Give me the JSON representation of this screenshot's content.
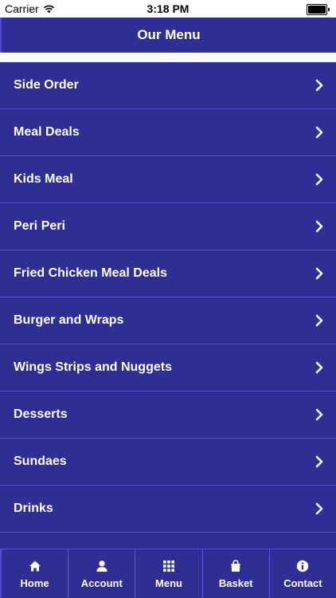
{
  "status_bar": {
    "carrier": "Carrier",
    "time": "3:18 PM"
  },
  "header": {
    "title": "Our Menu"
  },
  "menu": {
    "items": [
      {
        "label": "Side Order"
      },
      {
        "label": "Meal Deals"
      },
      {
        "label": "Kids Meal"
      },
      {
        "label": "Peri Peri"
      },
      {
        "label": "Fried Chicken Meal Deals"
      },
      {
        "label": "Burger and Wraps"
      },
      {
        "label": "Wings Strips and Nuggets"
      },
      {
        "label": "Desserts"
      },
      {
        "label": "Sundaes"
      },
      {
        "label": "Drinks"
      },
      {
        "label": ""
      }
    ]
  },
  "tab_bar": {
    "tabs": [
      {
        "label": "Home",
        "icon": "home-icon"
      },
      {
        "label": "Account",
        "icon": "user-icon"
      },
      {
        "label": "Menu",
        "icon": "grid-icon"
      },
      {
        "label": "Basket",
        "icon": "bag-icon"
      },
      {
        "label": "Contact",
        "icon": "info-icon"
      }
    ]
  },
  "colors": {
    "background": "#2e2e94",
    "divider": "#4f4fd8",
    "text": "#ffffff"
  }
}
